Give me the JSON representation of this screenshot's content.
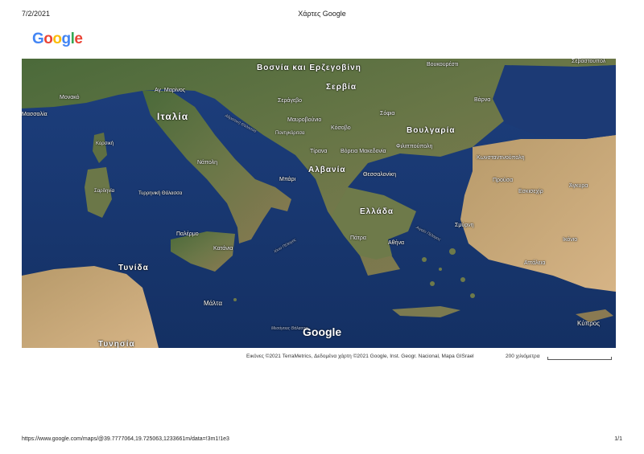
{
  "header": {
    "date": "7/2/2021",
    "title": "Χάρτες Google"
  },
  "logo": {
    "letters": [
      "G",
      "o",
      "o",
      "g",
      "l",
      "e"
    ],
    "colors": [
      "#4285F4",
      "#EA4335",
      "#FBBC05",
      "#4285F4",
      "#34A853",
      "#EA4335"
    ]
  },
  "map": {
    "watermark": "Google",
    "countries": {
      "bosnia": "Βοσνία και Ερζεγοβίνη",
      "serbia": "Σερβία",
      "italy": "Ιταλία",
      "bulgaria": "Βουλγαρία",
      "albania": "Αλβανία",
      "greece": "Ελλάδα",
      "tunisia": "Τυνίδα",
      "tunisia_bottom": "Τυνησία",
      "malta": "Μάλτα",
      "kosovo": "Κόσοβο",
      "montenegro": "Μαυροβούνιο",
      "n_macedonia": "Βόρεια Μακεδονία",
      "cyprus": "Κύπρος"
    },
    "cities": {
      "monaco": "Μονακό",
      "marseille": "Μασσαλία",
      "sarajevo": "Σεράγεβο",
      "sofia": "Σόφια",
      "bucharest": "Βουκουρέστι",
      "sevastopol": "Σεβαστούπολ",
      "varna": "Βάρνα",
      "plovdiv": "Φιλιππούπολη",
      "tirana": "Τίρανα",
      "skopje": "Σκόπια",
      "thessaloniki": "Θεσσαλονίκη",
      "istanbul": "Κωνσταντινούπολη",
      "bursa": "Προύσα",
      "ankara": "Άγκυρα",
      "eskisehir": "Εσκισεχίρ",
      "izmir": "Σμύρνη",
      "athens": "Αθήνα",
      "naples": "Νάπολη",
      "palermo": "Παλέρμο",
      "catania": "Κατάνια",
      "konya": "Ικόνιο",
      "antalya": "Αττάλεια",
      "san_marino": "Αγ. Μαρίνος",
      "patra": "Πάτρα",
      "bari": "Μπάρι",
      "podgorica": "Ποντγκόριτσα",
      "corsica": "Κορσική",
      "sardinia": "Σαρδηνία",
      "tyrrhenian": "Τυρρηνική Θάλασσα"
    },
    "seas": {
      "adriatic": "Αδριατική Θάλασσα",
      "ionian": "Ιόνιο Πέλαγος",
      "aegean": "Αιγαίο Πέλαγος",
      "mediterranean": "Μεσόγειος Θάλασσα"
    }
  },
  "attribution": "Εικόνες ©2021 TerraMetrics, Δεδομένα χάρτη ©2021 Google, Inst. Geogr. Nacional, Mapa GISrael",
  "scale": {
    "label": "200 χιλιόμετρα"
  },
  "footer": {
    "url": "https://www.google.com/maps/@39.7777064,19.725063,1233661m/data=!3m1!1e3",
    "page": "1/1"
  }
}
